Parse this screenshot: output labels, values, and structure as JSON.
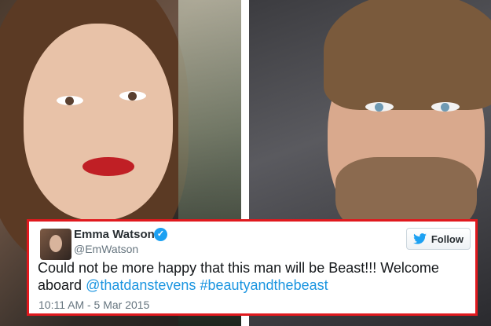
{
  "tweet": {
    "name": "Emma Watson",
    "handle": "@EmWatson",
    "follow_label": "Follow",
    "text_part1": "Could not be more happy that this man will be Beast!!! Welcome aboard ",
    "mention": "@thatdanstevens",
    "hashtag": "#beautyandthebeast",
    "timestamp": "10:11 AM - 5 Mar 2015",
    "icons": [
      "verified-badge-icon",
      "twitter-bird-icon"
    ],
    "colors": {
      "border": "#e0191e",
      "link": "#1b95e0",
      "verified": "#1da1f2"
    }
  }
}
